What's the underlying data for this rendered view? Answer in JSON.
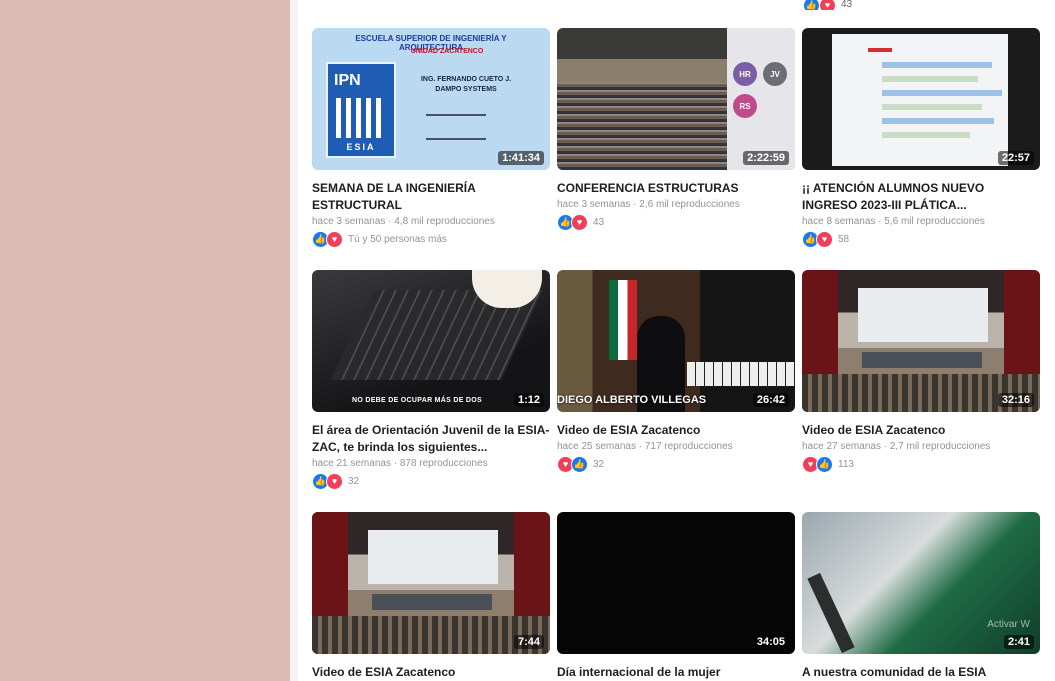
{
  "top_partial": {
    "reactions": [
      "like",
      "love"
    ],
    "count": "43"
  },
  "videos": [
    {
      "title": "SEMANA DE LA INGENIERÍA ESTRUCTURAL",
      "meta": "hace 3 semanas · 4,8 mil reproducciones",
      "duration": "1:41:34",
      "reactions": [
        "like",
        "love"
      ],
      "count": "Tú y 50 personas más",
      "thumb_text": {
        "line1": "ESCUELA SUPERIOR DE INGENIERÍA Y ARQUITECTURA",
        "line2": "UNIDAD ZACATENCO",
        "logo_top": "IPN",
        "logo_bottom": "ESIA",
        "name1": "ING. FERNANDO CUETO J.",
        "name2": "DAMPO SYSTEMS"
      }
    },
    {
      "title": "CONFERENCIA ESTRUCTURAS",
      "meta": "hace 3 semanas · 2,6 mil reproducciones",
      "duration": "2:22:59",
      "reactions": [
        "like",
        "love"
      ],
      "count": "43",
      "thumb_text": {
        "av1": "HR",
        "av2": "JV",
        "av3": "RS"
      }
    },
    {
      "title": "¡¡ ATENCIÓN ALUMNOS NUEVO INGRESO 2023-III PLÁTICA...",
      "meta": "hace 8 semanas · 5,6 mil reproducciones",
      "duration": "22:57",
      "reactions": [
        "like",
        "love"
      ],
      "count": "58"
    },
    {
      "title": "El área de Orientación Juvenil de la ESIA-ZAC, te brinda los siguientes...",
      "meta": "hace 21 semanas · 878 reproducciones",
      "duration": "1:12",
      "reactions": [
        "like",
        "love"
      ],
      "count": "32",
      "thumb_text": {
        "caption": "NO DEBE DE OCUPAR MÁS DE DOS"
      }
    },
    {
      "title": "Video de ESIA Zacatenco",
      "meta": "hace 25 semanas · 717 reproducciones",
      "duration": "26:42",
      "reactions": [
        "love",
        "like"
      ],
      "count": "32",
      "thumb_text": {
        "caption": "DIEGO ALBERTO VILLEGAS"
      }
    },
    {
      "title": "Video de ESIA Zacatenco",
      "meta": "hace 27 semanas · 2,7 mil reproducciones",
      "duration": "32:16",
      "reactions": [
        "love",
        "like"
      ],
      "count": "113"
    },
    {
      "title": "Video de ESIA Zacatenco",
      "meta": "",
      "duration": "7:44",
      "reactions": [],
      "count": ""
    },
    {
      "title": "Día internacional de la mujer",
      "meta": "",
      "duration": "34:05",
      "reactions": [],
      "count": ""
    },
    {
      "title": "A nuestra comunidad de la ESIA",
      "meta": "",
      "duration": "2:41",
      "reactions": [],
      "count": "",
      "thumb_text": {
        "watermark": "Activar W"
      }
    }
  ]
}
